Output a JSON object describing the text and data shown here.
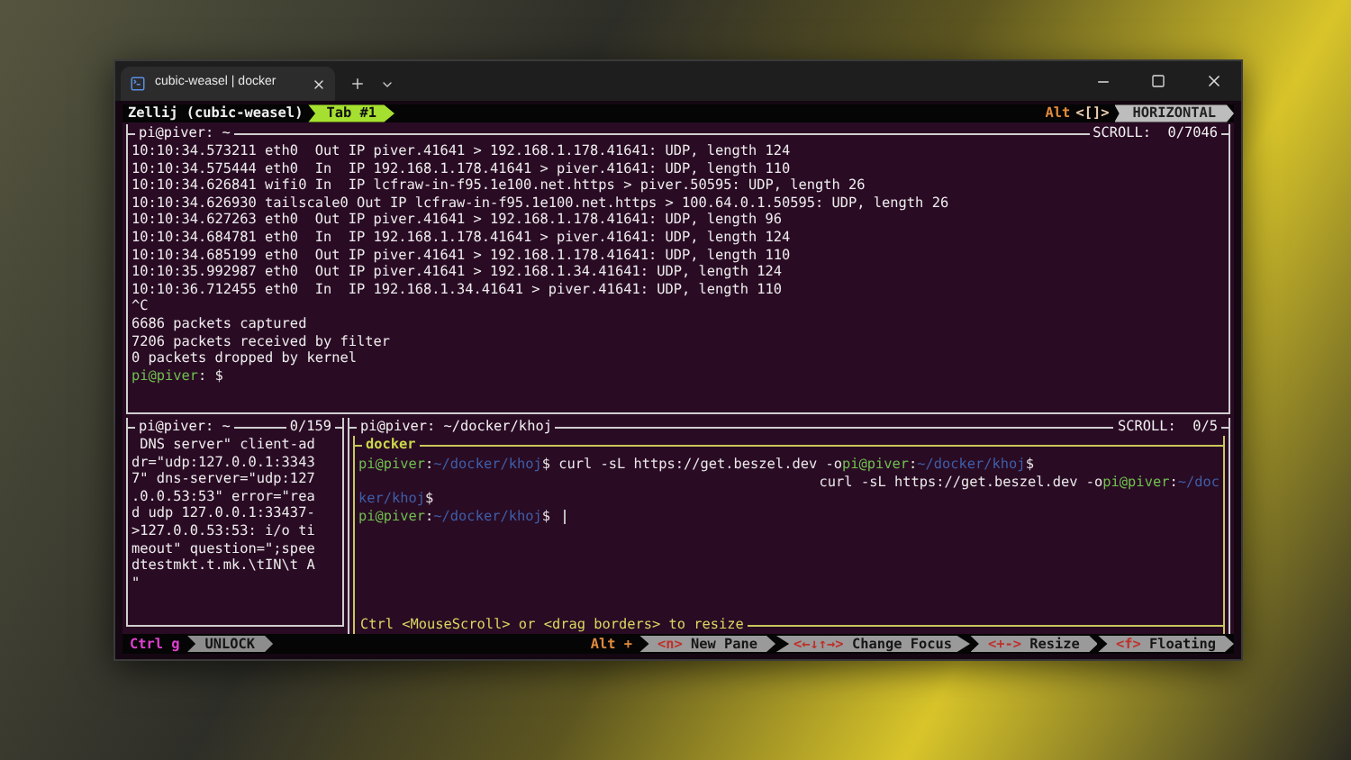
{
  "window": {
    "tab_title": "cubic-weasel | docker"
  },
  "zellij": {
    "session": "Zellij (cubic-weasel)",
    "tabs": [
      {
        "label": "Tab #1",
        "selected": true
      }
    ],
    "mode_key": "Alt",
    "mode_hint": "<[]>",
    "layout": "HORIZONTAL"
  },
  "top_pane": {
    "title": "pi@piver: ~",
    "scroll": "SCROLL:  0/7046",
    "focused": false,
    "lines": [
      {
        "text": "10:10:34.573211 eth0  Out IP piver.41641 > 192.168.1.178.41641: UDP, length 124"
      },
      {
        "text": "10:10:34.575444 eth0  In  IP 192.168.1.178.41641 > piver.41641: UDP, length 110"
      },
      {
        "text": "10:10:34.626841 wifi0 In  IP lcfraw-in-f95.1e100.net.https > piver.50595: UDP, length 26"
      },
      {
        "text": "10:10:34.626930 tailscale0 Out IP lcfraw-in-f95.1e100.net.https > 100.64.0.1.50595: UDP, length 26"
      },
      {
        "text": "10:10:34.627263 eth0  Out IP piver.41641 > 192.168.1.178.41641: UDP, length 96"
      },
      {
        "text": "10:10:34.684781 eth0  In  IP 192.168.1.178.41641 > piver.41641: UDP, length 124"
      },
      {
        "text": "10:10:34.685199 eth0  Out IP piver.41641 > 192.168.1.178.41641: UDP, length 110"
      },
      {
        "text": "10:10:35.992987 eth0  Out IP piver.41641 > 192.168.1.34.41641: UDP, length 124"
      },
      {
        "text": "10:10:36.712455 eth0  In  IP 192.168.1.34.41641 > piver.41641: UDP, length 110"
      },
      {
        "text": "^C"
      },
      {
        "text": "6686 packets captured"
      },
      {
        "text": "7206 packets received by filter"
      },
      {
        "text": "0 packets dropped by kernel"
      },
      {
        "segments": [
          {
            "kind": "user",
            "text": "pi@piver"
          },
          {
            "kind": "plain",
            "text": ": $"
          }
        ]
      }
    ]
  },
  "bottom_left_pane": {
    "title": "pi@piver: ~",
    "scroll": "0/159",
    "focused": false,
    "lines": [
      {
        "text": " DNS server\" client-ad"
      },
      {
        "text": "dr=\"udp:127.0.0.1:3343"
      },
      {
        "text": "7\" dns-server=\"udp:127"
      },
      {
        "text": ".0.0.53:53\" error=\"rea"
      },
      {
        "text": "d udp 127.0.0.1:33437-"
      },
      {
        "text": ">127.0.0.53:53: i/o ti"
      },
      {
        "text": "meout\" question=\";spee"
      },
      {
        "text": "dtestmkt.t.mk.\\tIN\\t A"
      },
      {
        "text": "\""
      }
    ]
  },
  "bottom_right_pane": {
    "title": "pi@piver: ~/docker/khoj",
    "scroll": "SCROLL:  0/5",
    "focused": false,
    "frame": {
      "title": "docker",
      "focused": true,
      "footer": "Ctrl <MouseScroll> or <drag borders> to resize",
      "lines": [
        {
          "segments": [
            {
              "kind": "user",
              "text": "pi@piver"
            },
            {
              "kind": "plain",
              "text": ":"
            },
            {
              "kind": "path",
              "text": "~/docker/khoj"
            },
            {
              "kind": "plain",
              "text": "$ curl -sL https://get.beszel.dev -o"
            },
            {
              "kind": "user",
              "text": "pi@piver"
            },
            {
              "kind": "plain",
              "text": ":"
            },
            {
              "kind": "path",
              "text": "~/docker/khoj"
            },
            {
              "kind": "plain",
              "text": "$"
            }
          ]
        },
        {
          "wrapped": true,
          "segments": [
            {
              "kind": "plain",
              "text": "curl -sL https://get.beszel.dev -o"
            },
            {
              "kind": "user",
              "text": "pi@piver"
            },
            {
              "kind": "plain",
              "text": ":"
            },
            {
              "kind": "path",
              "text": "~/doc"
            }
          ]
        },
        {
          "segments": [
            {
              "kind": "path",
              "text": "ker/khoj"
            },
            {
              "kind": "plain",
              "text": "$"
            }
          ]
        },
        {
          "cursor": true,
          "segments": [
            {
              "kind": "user",
              "text": "pi@piver"
            },
            {
              "kind": "plain",
              "text": ":"
            },
            {
              "kind": "path",
              "text": "~/docker/khoj"
            },
            {
              "kind": "plain",
              "text": "$"
            }
          ]
        }
      ]
    }
  },
  "status_bar": {
    "lock_key": "Ctrl g",
    "lock_label": "UNLOCK",
    "modifier": "Alt +",
    "shortcuts": [
      {
        "key": "<n>",
        "label": "New Pane"
      },
      {
        "key": "<←↓↑→>",
        "label": "Change Focus"
      },
      {
        "key": "<+->",
        "label": "Resize"
      },
      {
        "key": "<f>",
        "label": "Floating"
      }
    ]
  }
}
